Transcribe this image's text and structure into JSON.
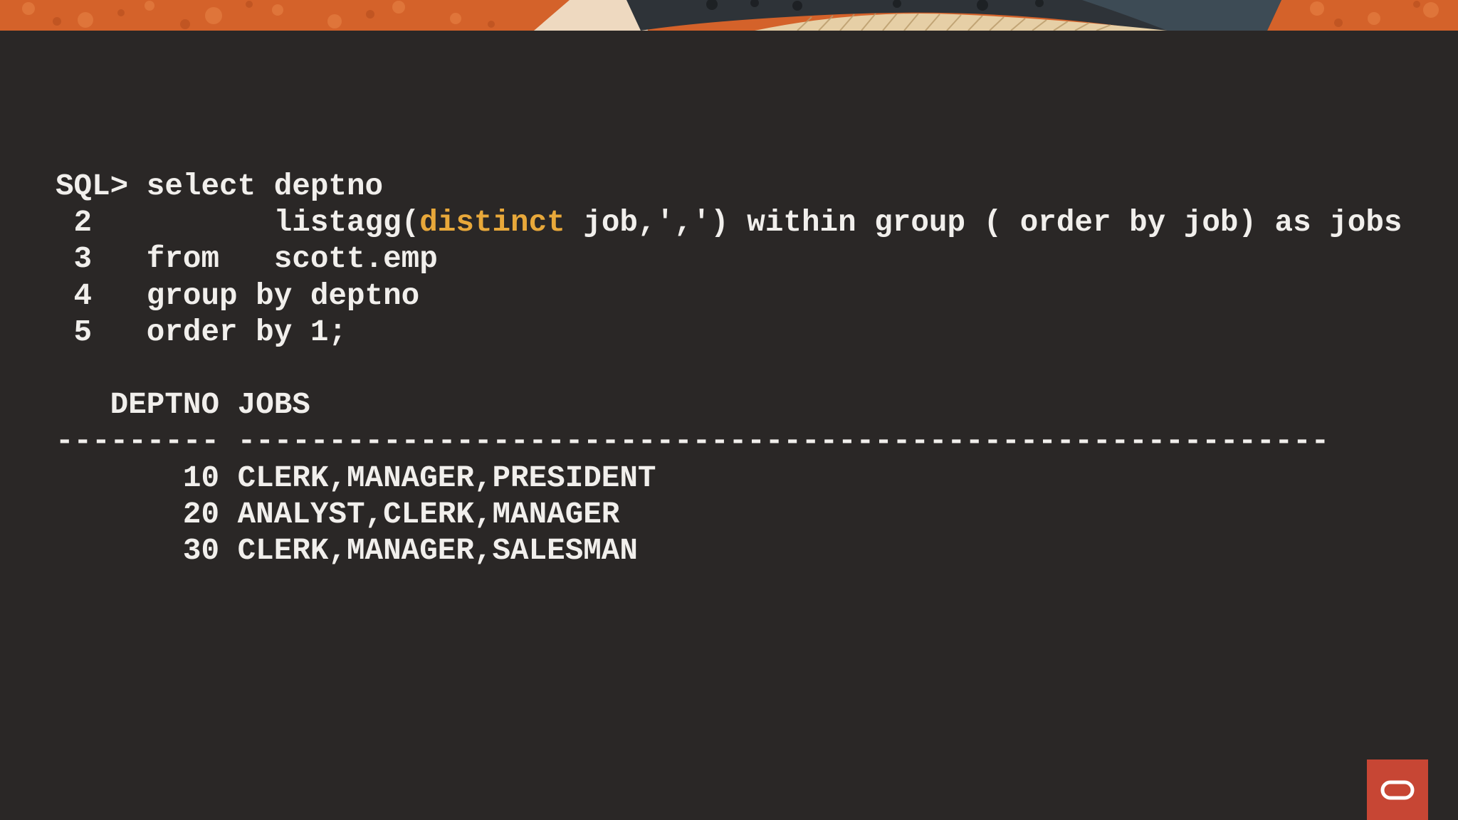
{
  "colors": {
    "background": "#2a2726",
    "text": "#f1efec",
    "keyword_highlight": "#e8a83a",
    "badge": "#c74634",
    "banner_orange": "#d4622a",
    "banner_slate": "#3d4b55",
    "banner_cream": "#eed9c0"
  },
  "sql": {
    "line1": "SQL> select deptno",
    "line2_before": " 2          listagg(",
    "line2_keyword": "distinct",
    "line2_after": " job,',') within group ( order by job) as jobs",
    "line3": " 3   from   scott.emp",
    "line4": " 4   group by deptno",
    "line5": " 5   order by 1;"
  },
  "result": {
    "header": "   DEPTNO JOBS",
    "separator": "--------- ------------------------------------------------------------",
    "rows": [
      "       10 CLERK,MANAGER,PRESIDENT",
      "       20 ANALYST,CLERK,MANAGER",
      "       30 CLERK,MANAGER,SALESMAN"
    ]
  },
  "icons": {
    "badge": "oracle-logo-icon"
  }
}
